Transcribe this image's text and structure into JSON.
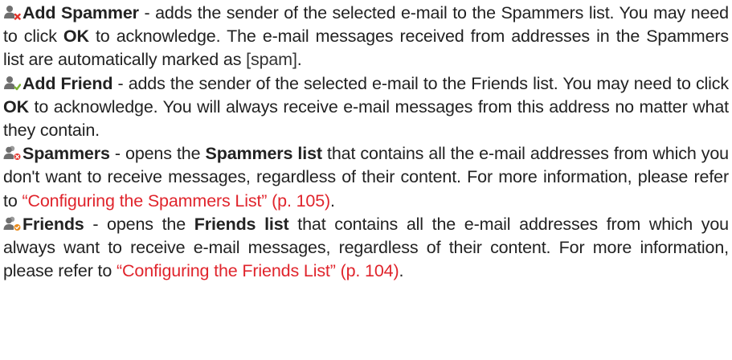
{
  "items": [
    {
      "icon": "add-spammer-icon",
      "title": "Add Spammer",
      "text_before_ok": " - adds the sender of the selected e-mail to the Spammers list. You may need to click ",
      "ok": "OK",
      "text_after_ok": " to acknowledge. The e-mail messages received from addresses in the Spammers list are automatically marked as ",
      "tag": "[spam]",
      "end": "."
    },
    {
      "icon": "add-friend-icon",
      "title": "Add Friend",
      "text_before_ok": " - adds the sender of the selected e-mail to the Friends list. You may need to click ",
      "ok": "OK",
      "text_after_ok": " to acknowledge. You will always receive e-mail messages from this address no matter what they contain."
    },
    {
      "icon": "spammers-list-icon",
      "title": "Spammers",
      "text_a": " - opens the ",
      "list_name": "Spammers list",
      "text_b": " that contains all the e-mail addresses from which you don't want to receive messages, regardless of their content. For more information, please refer to ",
      "link": "“Configuring the Spammers List” (p. 105)",
      "end": "."
    },
    {
      "icon": "friends-list-icon",
      "title": "Friends",
      "text_a": " - opens the ",
      "list_name": "Friends list",
      "text_b": " that contains all the e-mail addresses from which you always want to receive e-mail messages, regardless of their content. For more information, please refer to ",
      "link": "“Configuring the Friends List” (p. 104)",
      "end": "."
    }
  ],
  "colors": {
    "text": "#222222",
    "link": "#e0242c",
    "icon_person": "#6f6f6f",
    "icon_red": "#e2342b",
    "icon_green": "#7cb234",
    "icon_orange": "#e98b1c"
  }
}
